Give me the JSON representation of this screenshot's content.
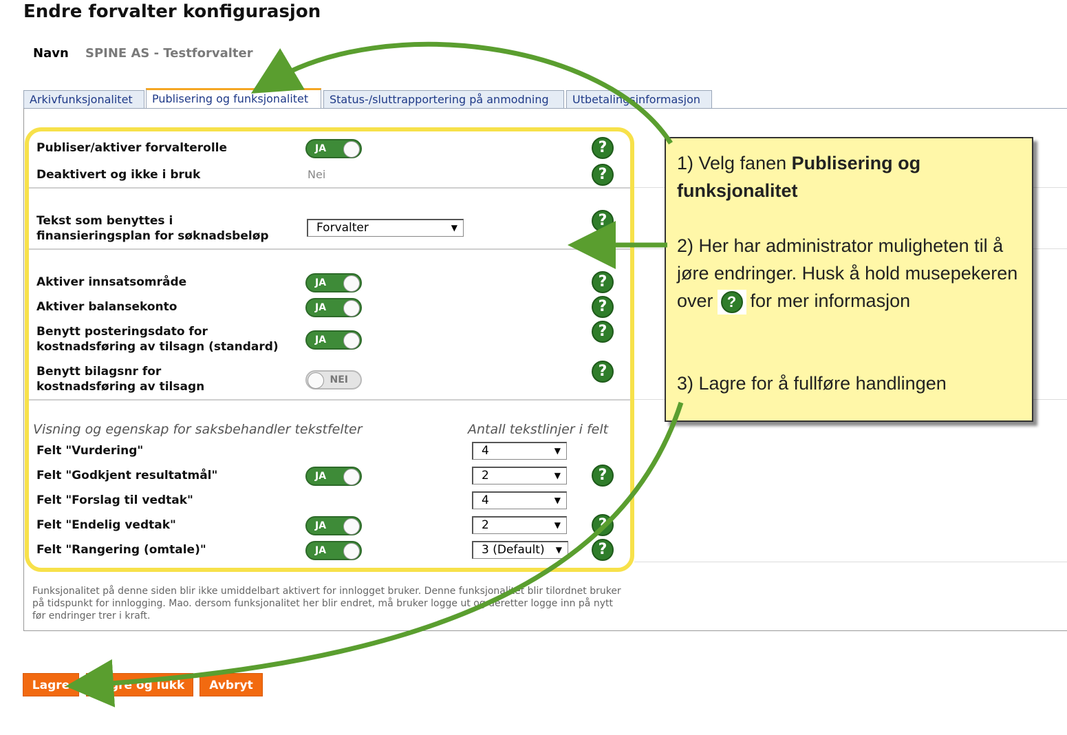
{
  "page": {
    "title": "Endre forvalter konfigurasjon",
    "navn_label": "Navn",
    "navn_value": "SPINE AS - Testforvalter"
  },
  "tabs": [
    {
      "label": "Arkivfunksjonalitet",
      "active": false
    },
    {
      "label": "Publisering og funksjonalitet",
      "active": true
    },
    {
      "label": "Status-/sluttrapportering på anmodning",
      "active": false
    },
    {
      "label": "Utbetalingsinformasjon",
      "active": false
    }
  ],
  "form": {
    "publiser": {
      "label": "Publiser/aktiver forvalterolle",
      "toggle": "JA"
    },
    "deaktivert": {
      "label": "Deaktivert og ikke i bruk",
      "value": "Nei"
    },
    "tekst": {
      "label_line1": "Tekst som benyttes i",
      "label_line2": "finansieringsplan for søknadsbeløp",
      "select": "Forvalter"
    },
    "innsats": {
      "label": "Aktiver innsatsområde",
      "toggle": "JA"
    },
    "balanse": {
      "label": "Aktiver balansekonto",
      "toggle": "JA"
    },
    "postering": {
      "label_line1": "Benytt posteringsdato for",
      "label_line2": "kostnadsføring av tilsagn (standard)",
      "toggle": "JA"
    },
    "bilagsnr": {
      "label_line1": "Benytt bilagsnr for",
      "label_line2": "kostnadsføring av tilsagn",
      "toggle": "NEI"
    },
    "section_heading": "Visning og egenskap for saksbehandler tekstfelter",
    "column_heading": "Antall tekstlinjer i felt",
    "felt": [
      {
        "label": "Felt \"Vurdering\"",
        "toggle": "",
        "lines": "4"
      },
      {
        "label": "Felt \"Godkjent resultatmål\"",
        "toggle": "JA",
        "lines": "2"
      },
      {
        "label": "Felt \"Forslag til vedtak\"",
        "toggle": "",
        "lines": "4"
      },
      {
        "label": "Felt \"Endelig vedtak\"",
        "toggle": "JA",
        "lines": "2"
      },
      {
        "label": "Felt \"Rangering (omtale)\"",
        "toggle": "JA",
        "lines": "3 (Default)"
      }
    ],
    "note": "Funksjonalitet på denne siden blir ikke umiddelbart aktivert for innlogget bruker. Denne funksjonalitet blir tilordnet bruker på tidspunkt for innlogging. Mao. dersom funksjonalitet her blir endret, må bruker logge ut og deretter logge inn på nytt før endringer trer i kraft.",
    "help_glyph": "?"
  },
  "buttons": {
    "lagre": "Lagre",
    "lagre_lukk": "Lagre og lukk",
    "avbryt": "Avbryt"
  },
  "callout": {
    "step1_prefix": "1) Velg fanen ",
    "step1_bold": "Publisering og funksjonalitet",
    "step2_a": "2) Her har administrator muligheten til å jøre endringer. Husk å hold musepekeren over",
    "step2_b": "for mer informasjon",
    "step3": "3) Lagre for å fullføre handlingen"
  },
  "colors": {
    "accent_orange": "#f26a10",
    "toggle_green": "#3e8b38",
    "highlight_yellow": "#f7e14a",
    "callout_bg": "#fff7a8",
    "arrow_green": "#5a9e2f"
  }
}
